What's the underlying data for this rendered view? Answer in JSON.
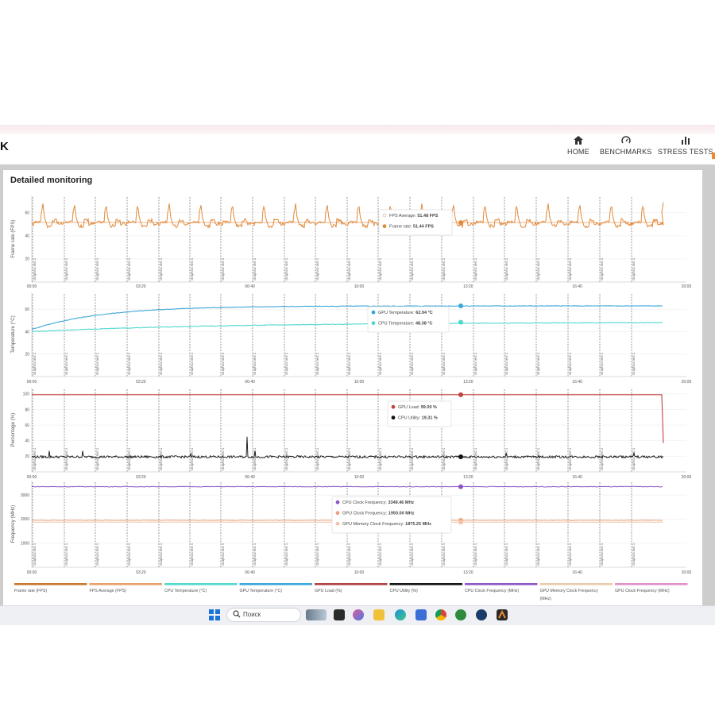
{
  "app": {
    "logo": "K",
    "nav": [
      {
        "label": "HOME",
        "icon": "home-icon"
      },
      {
        "label": "BENCHMARKS",
        "icon": "gauge-icon"
      },
      {
        "label": "STRESS TESTS",
        "icon": "bar-chart-icon"
      }
    ],
    "panel_title": "Detailed monitoring"
  },
  "taskbar": {
    "search_placeholder": "Поиск",
    "icons": [
      "windows-start-icon",
      "search-icon",
      "weather-widget-icon",
      "task-view-icon",
      "copilot-icon",
      "file-explorer-icon",
      "edge-icon",
      "browser-icon",
      "chrome-icon",
      "xbox-icon",
      "steam-icon",
      "3dmark-icon"
    ]
  },
  "chart_data": [
    {
      "type": "line",
      "ylabel": "Frame rate (FPS)",
      "yticks": [
        20,
        40,
        60
      ],
      "ylim": [
        0,
        75
      ],
      "xticks": [
        "00:00",
        "03:20",
        "06:40",
        "10:00",
        "13:20",
        "16:40",
        "20:00"
      ],
      "xlim_seconds": [
        0,
        1200
      ],
      "event_label": "Graphics test 1",
      "series": [
        {
          "name": "FPS Average",
          "color": "#f0b48a",
          "value": 51.48
        },
        {
          "name": "Frame rate",
          "color": "#e08a3c",
          "value": 51.44,
          "pattern": "repeating loop, baseline ~50, peaks ~66"
        }
      ],
      "tooltip": [
        {
          "label": "FPS Average:",
          "value": "51.48 FPS"
        },
        {
          "label": "Frame rate:",
          "value": "51.44 FPS"
        }
      ]
    },
    {
      "type": "line",
      "ylabel": "Temperature (°C)",
      "yticks": [
        20,
        40,
        60
      ],
      "ylim": [
        0,
        75
      ],
      "xticks": [
        "00:00",
        "03:20",
        "06:40",
        "10:00",
        "13:20",
        "16:40",
        "20:00"
      ],
      "event_label": "Graphics test 1",
      "series": [
        {
          "name": "GPU Temperature",
          "color": "#3aa6d8",
          "start": 42,
          "value": 62.94
        },
        {
          "name": "CPU Temperature",
          "color": "#4fd8cc",
          "start": 40,
          "value": 48.38
        }
      ],
      "tooltip": [
        {
          "label": "GPU Temperature:",
          "value": "62.94 °C"
        },
        {
          "label": "CPU Temperature:",
          "value": "48.38 °C"
        }
      ]
    },
    {
      "type": "line",
      "ylabel": "Percentage (%)",
      "yticks": [
        20,
        40,
        60,
        80,
        100
      ],
      "ylim": [
        0,
        108
      ],
      "xticks": [
        "00:00",
        "03:20",
        "06:40",
        "10:00",
        "13:20",
        "16:40",
        "20:00"
      ],
      "event_label": "Graphics test 1",
      "series": [
        {
          "name": "GPU Load",
          "color": "#c0433e",
          "value": 99.0,
          "end_value": 37
        },
        {
          "name": "CPU Utility",
          "color": "#111111",
          "value": 19.31
        }
      ],
      "tooltip": [
        {
          "label": "GPU Load:",
          "value": "99.00 %"
        },
        {
          "label": "CPU Utility:",
          "value": "19.31 %"
        }
      ]
    },
    {
      "type": "line",
      "ylabel": "Frequency (MHz)",
      "yticks": [
        1000,
        2000,
        3000
      ],
      "ylim": [
        0,
        3600
      ],
      "xticks": [
        "00:00",
        "03:20",
        "06:40",
        "10:00",
        "13:20",
        "16:40",
        "20:00"
      ],
      "event_label": "Graphics test 1",
      "series": [
        {
          "name": "CPU Clock Frequency",
          "color": "#8e55c4",
          "value": 3349.46
        },
        {
          "name": "GPU Clock Frequency",
          "color": "#e9a27a",
          "value": 1950.0
        },
        {
          "name": "GPU Memory Clock Frequency",
          "color": "#f2c3a8",
          "value": 1875.25
        }
      ],
      "tooltip": [
        {
          "label": "CPU Clock Frequency:",
          "value": "3349.46 MHz"
        },
        {
          "label": "GPU Clock Frequency:",
          "value": "1950.00 MHz"
        },
        {
          "label": "GPU Memory Clock Frequency:",
          "value": "1875.25 MHz"
        }
      ]
    }
  ],
  "legend": [
    {
      "label": "Frame rate (FPS)",
      "color": "#c9772e"
    },
    {
      "label": "FPS Average (FPS)",
      "color": "#e8a06a"
    },
    {
      "label": "CPU Temperature (°C)",
      "color": "#4fd8cc"
    },
    {
      "label": "GPU Temperature (°C)",
      "color": "#3aa6d8"
    },
    {
      "label": "GPU Load (%)",
      "color": "#b04040"
    },
    {
      "label": "CPU Utility (%)",
      "color": "#111111"
    },
    {
      "label": "CPU Clock Frequency (MHz)",
      "color": "#8e55c4"
    },
    {
      "label": "GPU Memory Clock Frequency (MHz)",
      "color": "#e6cda8"
    },
    {
      "label": "GPU Clock Frequency (MHz)",
      "color": "#e090c8"
    }
  ]
}
